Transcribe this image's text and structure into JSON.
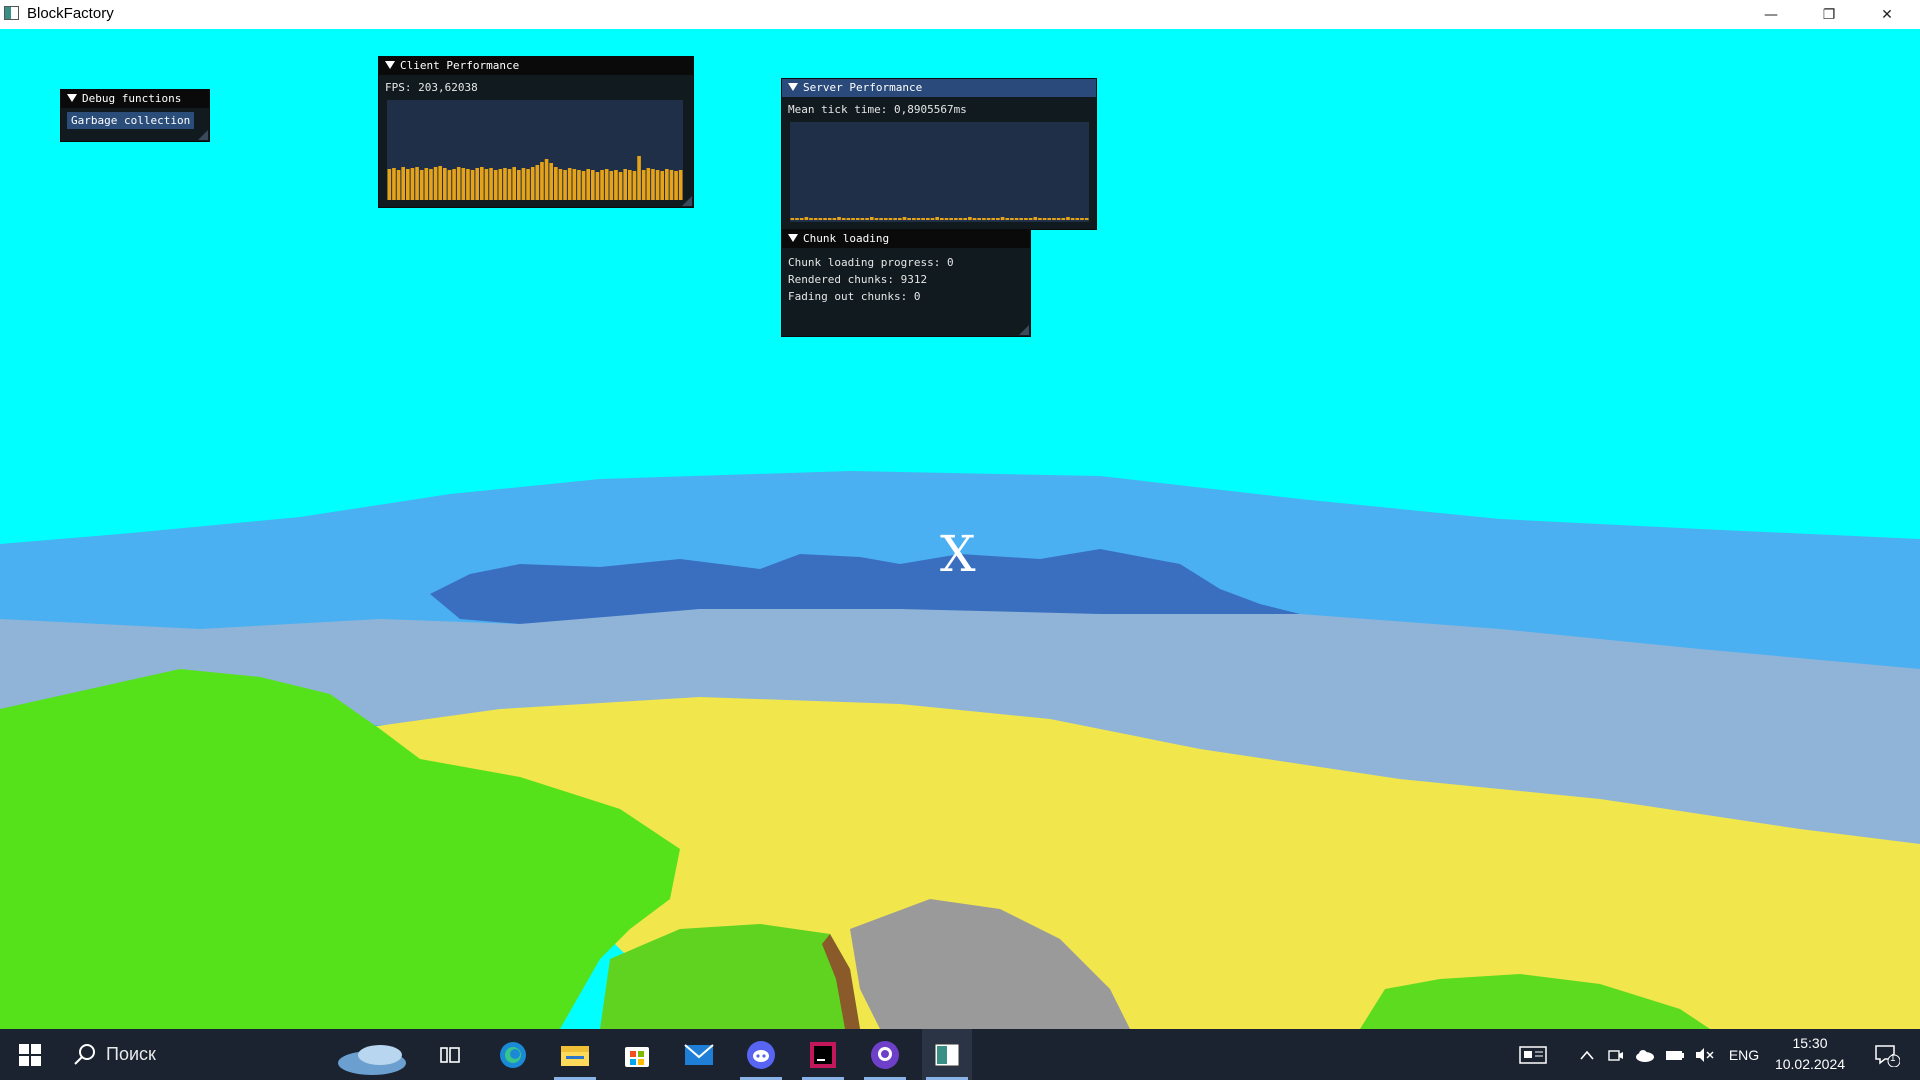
{
  "window": {
    "title": "BlockFactory",
    "minimize_glyph": "—",
    "maximize_glyph": "❐",
    "close_glyph": "✕"
  },
  "crosshair": "X",
  "debug_panel": {
    "title": "Debug functions",
    "button_label": "Garbage collection"
  },
  "client_panel": {
    "title": "Client Performance",
    "fps_text": "FPS: 203,62038",
    "plot_color": "#e6a317",
    "frame_values": [
      0.31,
      0.32,
      0.3,
      0.33,
      0.31,
      0.32,
      0.33,
      0.3,
      0.32,
      0.31,
      0.33,
      0.34,
      0.32,
      0.3,
      0.31,
      0.33,
      0.32,
      0.31,
      0.3,
      0.32,
      0.33,
      0.31,
      0.32,
      0.3,
      0.31,
      0.32,
      0.31,
      0.33,
      0.3,
      0.32,
      0.31,
      0.33,
      0.35,
      0.38,
      0.41,
      0.37,
      0.33,
      0.31,
      0.3,
      0.32,
      0.31,
      0.3,
      0.29,
      0.31,
      0.3,
      0.28,
      0.3,
      0.31,
      0.29,
      0.3,
      0.28,
      0.31,
      0.3,
      0.29,
      0.44,
      0.3,
      0.32,
      0.31,
      0.3,
      0.29,
      0.31,
      0.3,
      0.29,
      0.3
    ]
  },
  "server_panel": {
    "title": "Server Performance",
    "tick_text": "Mean tick time: 0,8905567ms",
    "plot_color": "#e6a317"
  },
  "chunk_panel": {
    "title": "Chunk loading",
    "progress_text": "Chunk loading progress: 0",
    "rendered_text": "Rendered chunks: 9312",
    "fading_text": "Fading out chunks: 0"
  },
  "taskbar": {
    "search_placeholder": "Поиск",
    "language": "ENG",
    "time": "15:30",
    "date": "10.02.2024",
    "notification_count": "1",
    "apps": [
      "edge-icon",
      "file-explorer-icon",
      "store-icon",
      "mail-icon",
      "discord-icon",
      "rider-icon",
      "github-desktop-icon",
      "blockfactory-icon"
    ]
  },
  "colors": {
    "sky": "#00ffff",
    "water": "#4ab0f2",
    "deep_water": "#3a6fc0",
    "sand": "#f1e64c",
    "grass": "#55e21a",
    "stone": "#9a9a9a",
    "panel_title_active": "#294a7a"
  }
}
